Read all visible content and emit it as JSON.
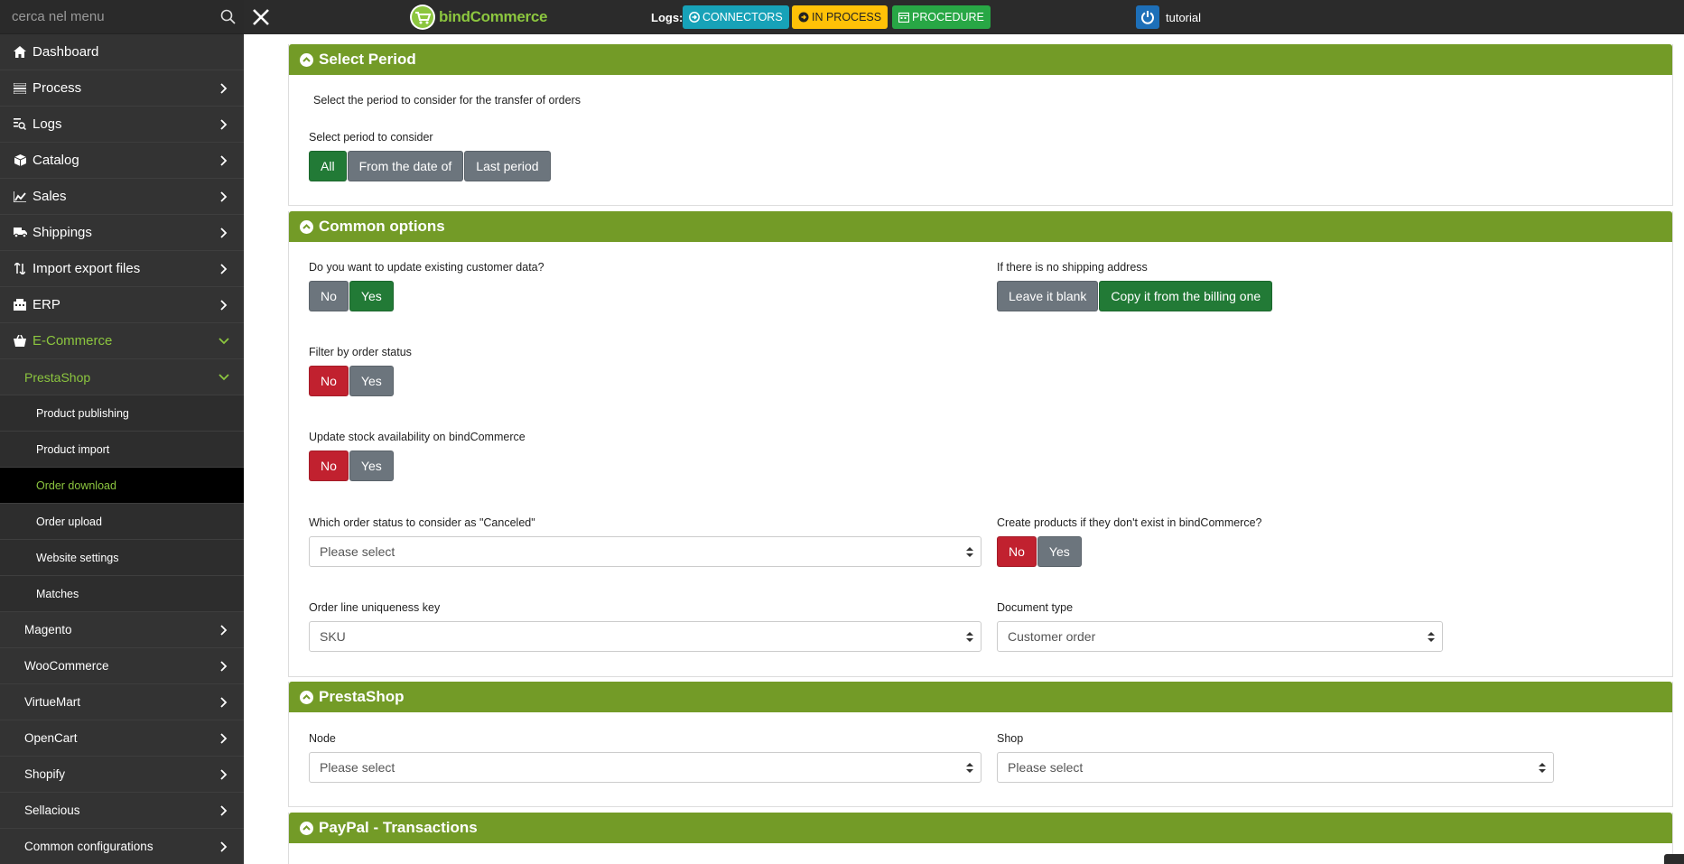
{
  "search": {
    "placeholder": "cerca nel menu"
  },
  "sidebar": {
    "items": [
      {
        "label": "Dashboard",
        "icon": "home-icon"
      },
      {
        "label": "Process",
        "icon": "process-icon"
      },
      {
        "label": "Logs",
        "icon": "logs-icon"
      },
      {
        "label": "Catalog",
        "icon": "cube-icon"
      },
      {
        "label": "Sales",
        "icon": "chart-icon"
      },
      {
        "label": "Shippings",
        "icon": "truck-icon"
      },
      {
        "label": "Import export files",
        "icon": "sort-icon"
      },
      {
        "label": "ERP",
        "icon": "building-icon"
      },
      {
        "label": "E-Commerce",
        "icon": "basket-icon"
      }
    ],
    "ecommerce_sub": "PrestaShop",
    "presta_sub": [
      "Product publishing",
      "Product import",
      "Order download",
      "Order upload",
      "Website settings",
      "Matches"
    ],
    "platforms": [
      "Magento",
      "WooCommerce",
      "VirtueMart",
      "OpenCart",
      "Shopify",
      "Sellacious",
      "Common configurations"
    ]
  },
  "topbar": {
    "logo": "bindCommerce",
    "logs_label": "Logs:",
    "badges": [
      "CONNECTORS",
      "IN PROCESS",
      "PROCEDURE"
    ],
    "user": "tutorial"
  },
  "panels": {
    "period": {
      "title": "Select Period",
      "description": "Select the period to consider for the transfer of orders",
      "label": "Select period to consider",
      "options": [
        "All",
        "From the date of",
        "Last period"
      ],
      "selected": "All"
    },
    "common": {
      "title": "Common options",
      "update_customer": {
        "label": "Do you want to update existing customer data?",
        "no": "No",
        "yes": "Yes",
        "selected": "Yes"
      },
      "no_shipping": {
        "label": "If there is no shipping address",
        "opt1": "Leave it blank",
        "opt2": "Copy it from the billing one",
        "selected": "Copy it from the billing one"
      },
      "filter_status": {
        "label": "Filter by order status",
        "no": "No",
        "yes": "Yes",
        "selected": "No"
      },
      "update_stock": {
        "label": "Update stock availability on bindCommerce",
        "no": "No",
        "yes": "Yes",
        "selected": "No"
      },
      "canceled_status": {
        "label": "Which order status to consider as \"Canceled\"",
        "value": "Please select"
      },
      "create_products": {
        "label": "Create products if they don't exist in bindCommerce?",
        "no": "No",
        "yes": "Yes",
        "selected": "No"
      },
      "uniqueness": {
        "label": "Order line uniqueness key",
        "value": "SKU"
      },
      "doc_type": {
        "label": "Document type",
        "value": "Customer order"
      }
    },
    "prestashop": {
      "title": "PrestaShop",
      "node": {
        "label": "Node",
        "value": "Please select"
      },
      "shop": {
        "label": "Shop",
        "value": "Please select"
      }
    },
    "paypal": {
      "title": "PayPal - Transactions"
    }
  },
  "colors": {
    "accent": "#739b27",
    "green": "#227a36",
    "red": "#c1212f",
    "gray": "#6c757d",
    "sidebar": "#333333"
  }
}
